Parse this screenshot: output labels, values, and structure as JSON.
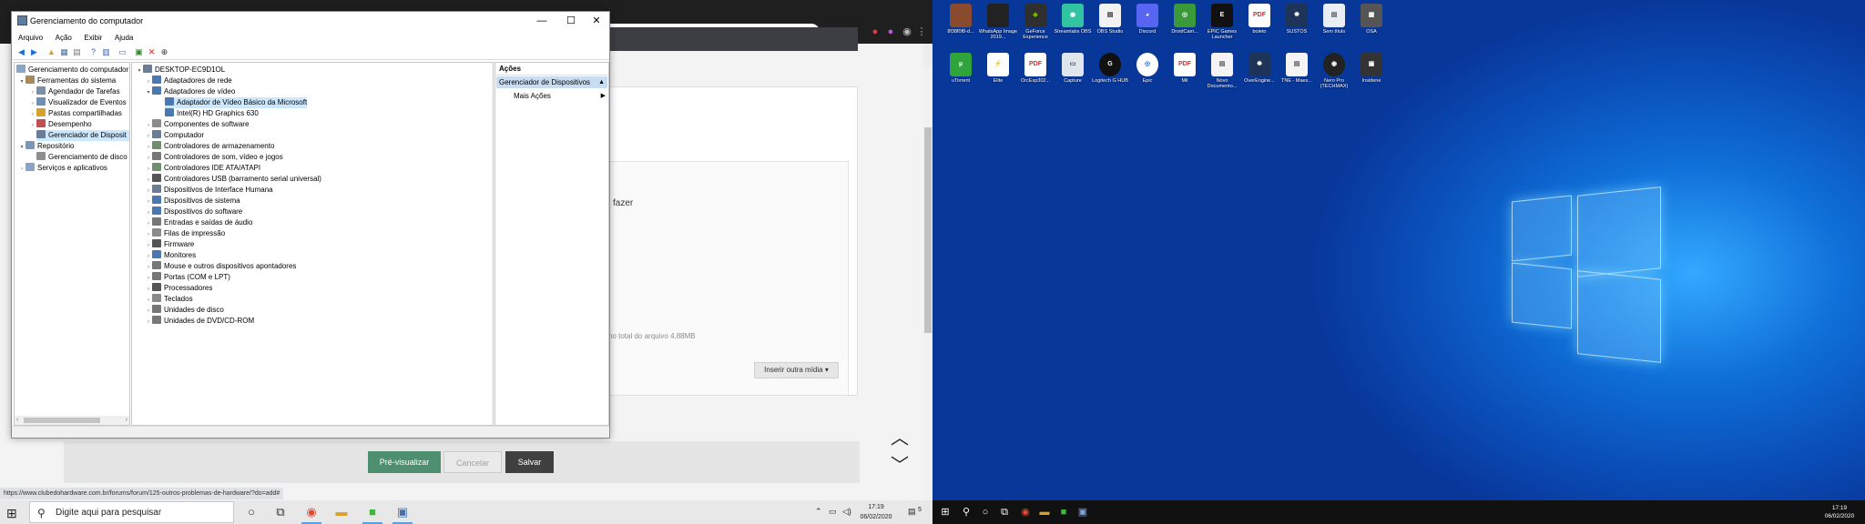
{
  "cm": {
    "title": "Gerenciamento do computador",
    "menu": [
      "Arquivo",
      "Ação",
      "Exibir",
      "Ajuda"
    ],
    "left_tree": [
      "Gerenciamento do computador",
      "Ferramentas do sistema",
      "Agendador de Tarefas",
      "Visualizador de Eventos",
      "Pastas compartilhadas",
      "Desempenho",
      "Gerenciador de Disposit",
      "Repositório",
      "Gerenciamento de disco",
      "Serviços e aplicativos"
    ],
    "device_tree": [
      "DESKTOP-EC9D1OL",
      "Adaptadores de rede",
      "Adaptadores de vídeo",
      "Adaptador de Vídeo Básico da Microsoft",
      "Intel(R) HD Graphics 630",
      "Componentes de software",
      "Computador",
      "Controladores de armazenamento",
      "Controladores de som, vídeo e jogos",
      "Controladores IDE ATA/ATAPI",
      "Controladores USB (barramento serial universal)",
      "Dispositivos de Interface Humana",
      "Dispositivos de sistema",
      "Dispositivos do software",
      "Entradas e saídas de áudio",
      "Filas de impressão",
      "Firmware",
      "Monitores",
      "Mouse e outros dispositivos apontadores",
      "Portas (COM e LPT)",
      "Processadores",
      "Teclados",
      "Unidades de disco",
      "Unidades de DVD/CD-ROM"
    ],
    "actions": {
      "header": "Ações",
      "selected": "Gerenciador de Dispositivos",
      "more": "Mais Ações"
    }
  },
  "browser": {
    "page_text": "fazer",
    "file_total_label": "no total do arquivo",
    "file_total_value": "4,88MB",
    "insert_button": "Inserir outra mídia ▾",
    "preview_button": "Pré-visualizar",
    "cancel_button": "Cancelar",
    "save_button": "Salvar",
    "status_url": "https://www.clubedohardware.com.br/forums/forum/125-outros-problemas-de-hardware/?do=add#"
  },
  "taskbar_left": {
    "search_placeholder": "Digite aqui para pesquisar",
    "time": "17:19",
    "date": "06/02/2020",
    "notif_count": "5"
  },
  "taskbar_right": {
    "time": "17:19",
    "date": "06/02/2020"
  },
  "desktop_icons": [
    {
      "label": "8f38f0f8-d..."
    },
    {
      "label": "WhatsApp Image 2019..."
    },
    {
      "label": "GeForce Experience"
    },
    {
      "label": "Streamlabs OBS"
    },
    {
      "label": "OBS Studio"
    },
    {
      "label": "Discord"
    },
    {
      "label": "DroidCam..."
    },
    {
      "label": "EPIC Games Launcher"
    },
    {
      "label": "boleto"
    },
    {
      "label": "SUSTOS"
    },
    {
      "label": "Sem título"
    },
    {
      "label": "OSA"
    },
    {
      "label": "uTorrent"
    },
    {
      "label": "Elite"
    },
    {
      "label": "OrcExp302..."
    },
    {
      "label": "Capture"
    },
    {
      "label": "Logitech G HUB"
    },
    {
      "label": "Epic"
    },
    {
      "label": "Mil"
    },
    {
      "label": "Novo Documento..."
    },
    {
      "label": "OverEngine..."
    },
    {
      "label": "TNE - Maes..."
    },
    {
      "label": "Nero Pro (TECHMAX)"
    },
    {
      "label": "Insidene"
    }
  ],
  "colors": {
    "desktop_bg": "#0a4cb6",
    "selection": "#cce8ff",
    "preview_btn": "#4d8f6f",
    "save_btn": "#404040"
  }
}
